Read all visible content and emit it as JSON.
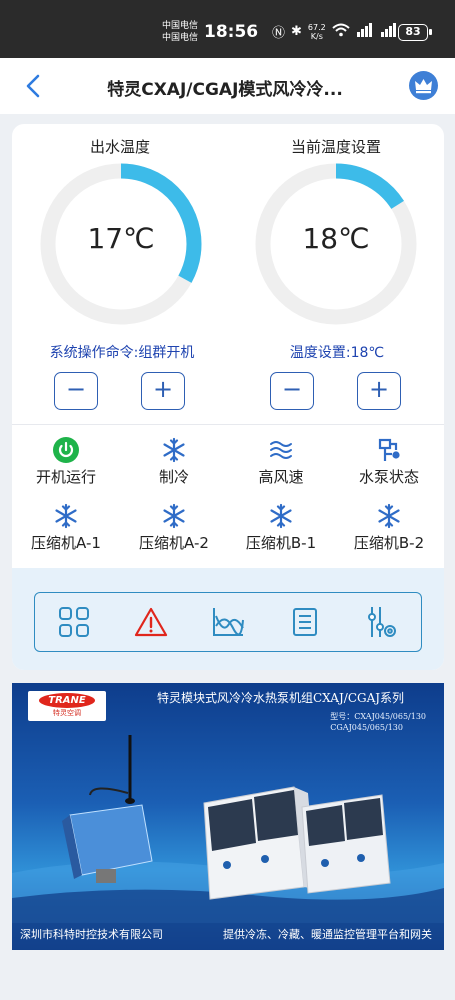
{
  "statusbar": {
    "carrier1": "中国电信",
    "carrier2": "中国电信",
    "time": "18:56",
    "net_speed": "67.2",
    "net_unit": "K/s",
    "battery": "83"
  },
  "nav": {
    "title": "特灵CXAJ/CGAJ模式风冷冷..."
  },
  "gauges": [
    {
      "label": "出水温度",
      "value": "17℃",
      "fill": 0.33
    },
    {
      "label": "当前温度设置",
      "value": "18℃",
      "fill": 0.16
    }
  ],
  "controls": {
    "command": "系统操作命令:组群开机",
    "temp_setting": "温度设置:18℃",
    "minus": "−",
    "plus": "+"
  },
  "status_items": [
    {
      "label": "开机运行",
      "icon": "power-icon"
    },
    {
      "label": "制冷",
      "icon": "snowflake-icon"
    },
    {
      "label": "高风速",
      "icon": "wind-icon"
    },
    {
      "label": "水泵状态",
      "icon": "pump-icon"
    },
    {
      "label": "压缩机A-1",
      "icon": "snowflake-icon"
    },
    {
      "label": "压缩机A-2",
      "icon": "snowflake-icon"
    },
    {
      "label": "压缩机B-1",
      "icon": "snowflake-icon"
    },
    {
      "label": "压缩机B-2",
      "icon": "snowflake-icon"
    }
  ],
  "toolbar": [
    "grid-icon",
    "alarm-icon",
    "trend-chart-icon",
    "list-icon",
    "settings-sliders-icon"
  ],
  "banner": {
    "title": "特灵模块式风冷冷水热泵机组CXAJ/CGAJ系列",
    "model_line1": "型号：CXAJ045/065/130",
    "model_line2": "CGAJ045/065/130",
    "brand": "TRANE",
    "brand_cn": "特灵空调",
    "company": "深圳市科特时控技术有限公司",
    "slogan": "提供冷冻、冷藏、暖通监控管理平台和网关"
  },
  "colors": {
    "accent": "#2e5fb3",
    "gauge_fill": "#3dbbe9",
    "gauge_track": "#efefef",
    "power_on": "#1fb34a",
    "icon_blue": "#2f6cc7",
    "alarm_red": "#e0261c",
    "tool_blue": "#2f8cc1"
  }
}
